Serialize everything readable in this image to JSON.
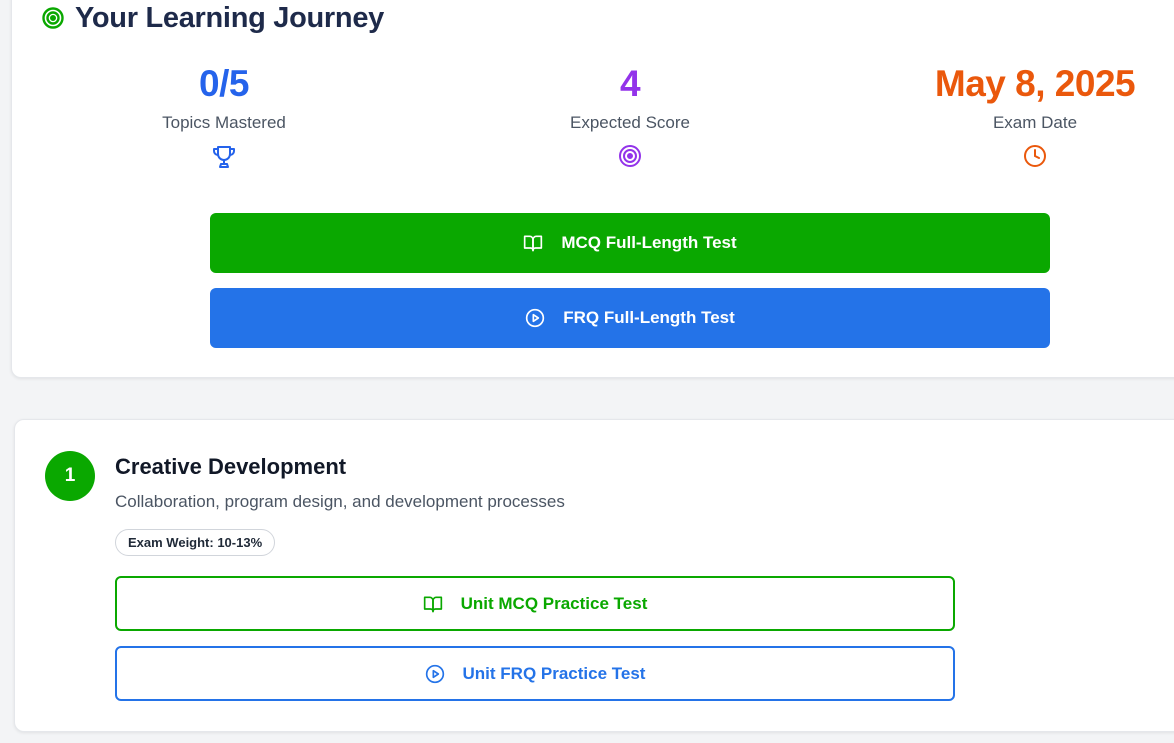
{
  "journey": {
    "title": "Your Learning Journey",
    "title_icon": "target-icon",
    "stats": {
      "topics": {
        "value": "0/5",
        "label": "Topics Mastered",
        "icon": "trophy-icon",
        "color": "#2563eb"
      },
      "score": {
        "value": "4",
        "label": "Expected Score",
        "icon": "target-icon",
        "color": "#9333ea"
      },
      "date": {
        "value": "May 8, 2025",
        "label": "Exam Date",
        "icon": "clock-icon",
        "color": "#ea580c"
      }
    },
    "mcq_button": {
      "label": "MCQ Full-Length Test",
      "icon": "book-open-icon",
      "color": "#0aa800"
    },
    "frq_button": {
      "label": "FRQ Full-Length Test",
      "icon": "play-circle-icon",
      "color": "#2473e8"
    }
  },
  "unit": {
    "number": "1",
    "title": "Creative Development",
    "description": "Collaboration, program design, and development processes",
    "weight_badge": "Exam Weight: 10-13%",
    "mcq_button": {
      "label": "Unit MCQ Practice Test",
      "icon": "book-open-icon",
      "color": "#0aa800"
    },
    "frq_button": {
      "label": "Unit FRQ Practice Test",
      "icon": "play-circle-icon",
      "color": "#2473e8"
    }
  }
}
